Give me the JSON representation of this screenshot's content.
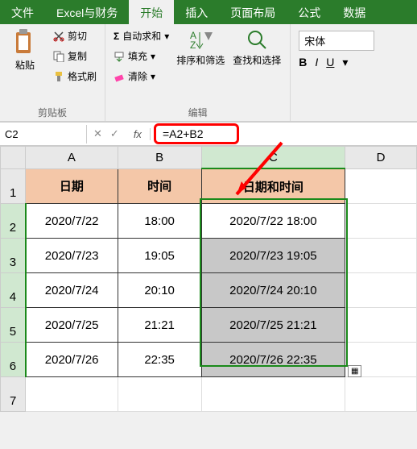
{
  "tabs": {
    "file": "文件",
    "excel_finance": "Excel与财务",
    "home": "开始",
    "insert": "插入",
    "page_layout": "页面布局",
    "formulas": "公式",
    "data": "数据"
  },
  "ribbon": {
    "clipboard": {
      "label": "剪贴板",
      "paste": "粘贴",
      "cut": "剪切",
      "copy": "复制",
      "format_painter": "格式刷"
    },
    "editing": {
      "label": "编辑",
      "autosum": "自动求和",
      "fill": "填充",
      "clear": "清除",
      "sort_filter": "排序和筛选",
      "find_select": "查找和选择"
    },
    "font": {
      "name": "宋体",
      "bold": "B",
      "italic": "I",
      "underline": "U"
    }
  },
  "namebox": "C2",
  "fx": "fx",
  "formula": "=A2+B2",
  "columns": [
    "A",
    "B",
    "C",
    "D"
  ],
  "rows": [
    "1",
    "2",
    "3",
    "4",
    "5",
    "6",
    "7"
  ],
  "grid": {
    "headers": {
      "date": "日期",
      "time": "时间",
      "datetime": "日期和时间"
    },
    "data": [
      {
        "date": "2020/7/22",
        "time": "18:00",
        "datetime": "2020/7/22 18:00"
      },
      {
        "date": "2020/7/23",
        "time": "19:05",
        "datetime": "2020/7/23 19:05"
      },
      {
        "date": "2020/7/24",
        "time": "20:10",
        "datetime": "2020/7/24 20:10"
      },
      {
        "date": "2020/7/25",
        "time": "21:21",
        "datetime": "2020/7/25 21:21"
      },
      {
        "date": "2020/7/26",
        "time": "22:35",
        "datetime": "2020/7/26 22:35"
      }
    ]
  }
}
